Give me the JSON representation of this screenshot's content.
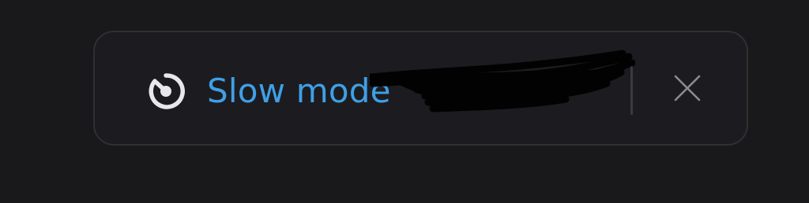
{
  "banner": {
    "icon": "slow-mode-timer-icon",
    "label": "Slow mode",
    "close_icon": "close-icon"
  },
  "colors": {
    "background": "#19191b",
    "banner_background": "#1c1c20",
    "banner_border": "#2f2f34",
    "label": "#3fa0e6",
    "icon": "#e8e8ea",
    "close_icon": "#8a8a90"
  }
}
